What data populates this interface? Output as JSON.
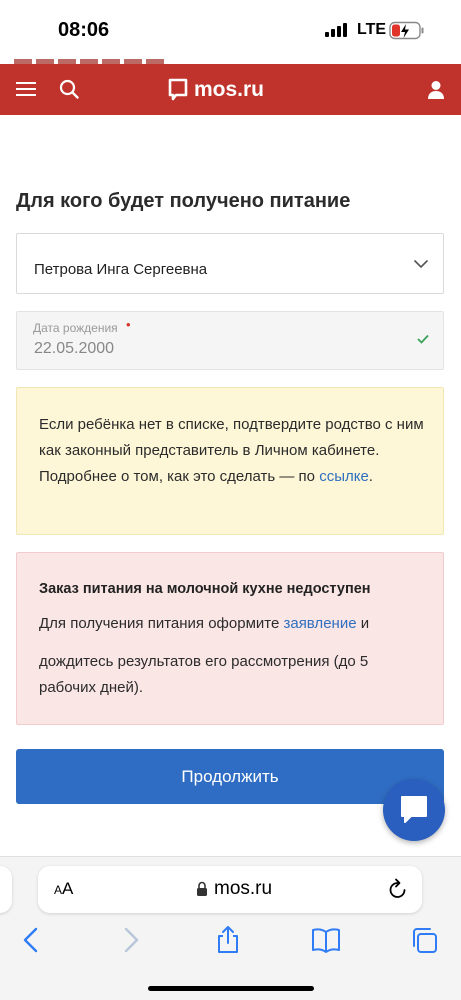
{
  "status_bar": {
    "time": "08:06",
    "network": "LTE"
  },
  "header": {
    "logo_text": "mos.ru",
    "brand_color": "#c0332d"
  },
  "form": {
    "heading": "Для кого будет получено питание",
    "recipient_select": {
      "value": "Петрова Инга Сергеевна"
    },
    "birth_date": {
      "label": "Дата рождения",
      "required_mark": "•",
      "value": "22.05.2000"
    }
  },
  "info_yellow": {
    "text_before_link": "Если ребёнка нет в списке, подтвердите родство с ним как законный представитель в Личном кабинете. Подробнее о том, как это сделать — по ",
    "link_text": "ссылке",
    "text_after_link": "."
  },
  "info_red": {
    "title": "Заказ питания на молочной кухне недоступен",
    "line1_before_link": "Для получения питания оформите ",
    "line1_link": "заявление",
    "line1_after_link": " и",
    "line2": "дождитесь результатов его рассмотрения (до 5 рабочих дней)."
  },
  "continue_button": {
    "label": "Продолжить",
    "color": "#2f6dc4"
  },
  "browser": {
    "aa_small": "A",
    "aa_large": "A",
    "url": "mos.ru"
  },
  "icons": [
    "hamburger-icon",
    "search-icon",
    "logo-bubble-icon",
    "user-icon",
    "chevron-down-icon",
    "check-icon",
    "chat-icon",
    "lock-icon",
    "reload-icon",
    "back-icon",
    "forward-icon",
    "share-icon",
    "bookmarks-icon",
    "tabs-icon"
  ]
}
